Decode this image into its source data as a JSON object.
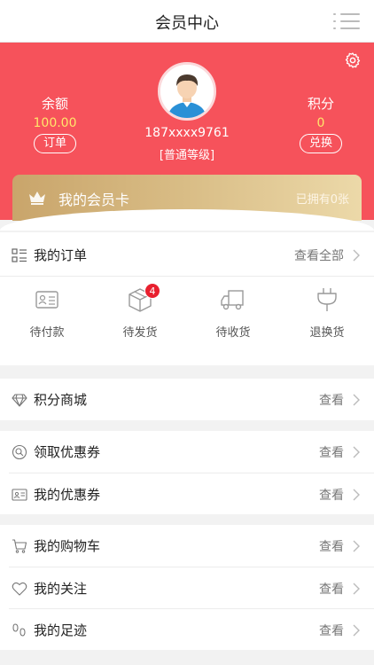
{
  "nav": {
    "title": "会员中心",
    "menu_icon": "menu-icon"
  },
  "profile": {
    "phone": "187xxxx9761",
    "level": "[普通等级]",
    "balance": {
      "label": "余额",
      "value": "100.00",
      "button": "订单"
    },
    "points": {
      "label": "积分",
      "value": "0",
      "button": "兑换"
    }
  },
  "vip_card": {
    "title": "我的会员卡",
    "count": "已拥有0张"
  },
  "orders": {
    "title": "我的订单",
    "view_all": "查看全部",
    "statuses": [
      {
        "label": "待付款",
        "icon": "wallet-icon"
      },
      {
        "label": "待发货",
        "icon": "box-icon",
        "badge": "4"
      },
      {
        "label": "待收货",
        "icon": "truck-icon"
      },
      {
        "label": "退换货",
        "icon": "exchange-icon"
      }
    ]
  },
  "menu": {
    "points_mall": {
      "label": "积分商城",
      "action": "查看"
    },
    "get_coupons": {
      "label": "领取优惠券",
      "action": "查看"
    },
    "my_coupons": {
      "label": "我的优惠券",
      "action": "查看"
    },
    "cart": {
      "label": "我的购物车",
      "action": "查看"
    },
    "follows": {
      "label": "我的关注",
      "action": "查看"
    },
    "history": {
      "label": "我的足迹",
      "action": "查看"
    }
  },
  "colors": {
    "header": "#f6525b",
    "accent_value": "#ffe66b",
    "badge": "#e8202f",
    "gold_card": "#d9bd86"
  }
}
